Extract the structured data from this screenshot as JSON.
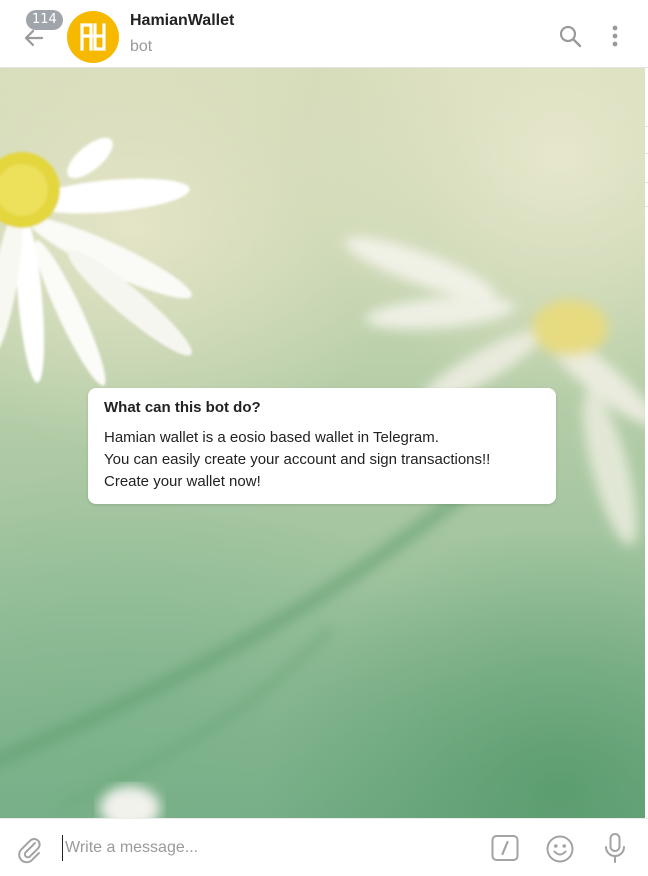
{
  "header": {
    "title": "HamianWallet",
    "status": "bot",
    "unread_count": "114",
    "icons": [
      "back-arrow-icon",
      "search-icon",
      "more-vertical-icon"
    ],
    "avatar_color": "#f6b900"
  },
  "bot_info": {
    "heading": "What can this bot do?",
    "lines": [
      "Hamian wallet is a eosio based wallet in Telegram.",
      "You can easily create your account and sign transactions!!",
      "Create your wallet now!"
    ]
  },
  "composer": {
    "placeholder": "Write a message...",
    "icons": [
      "paperclip-icon",
      "bot-commands-icon",
      "emoji-icon",
      "microphone-icon"
    ]
  },
  "colors": {
    "icon_gray": "#999999",
    "badge_gray": "#9fa5ab"
  }
}
